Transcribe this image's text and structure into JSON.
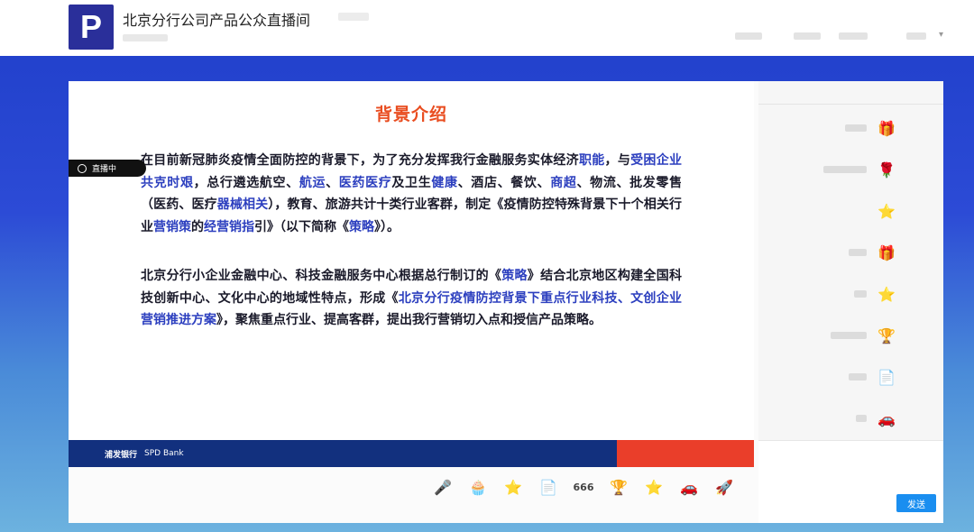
{
  "header": {
    "logo_letter": "P",
    "title": "北京分行公司产品公众直播间",
    "controls": [
      "",
      "",
      "",
      ""
    ]
  },
  "slide": {
    "heading": "背景介绍",
    "para1": [
      {
        "t": "在目前新冠肺炎疫情全面防控的背景下，为了充分发挥我行金融服务实体经济",
        "c": ""
      },
      {
        "t": "职能",
        "c": "blue"
      },
      {
        "t": "，与",
        "c": ""
      },
      {
        "t": "受困企业共克时艰",
        "c": "blue"
      },
      {
        "t": "，总行遴选航空、",
        "c": ""
      },
      {
        "t": "航运",
        "c": "blue"
      },
      {
        "t": "、",
        "c": ""
      },
      {
        "t": "医药医疗",
        "c": "blue"
      },
      {
        "t": "及卫生",
        "c": ""
      },
      {
        "t": "健康",
        "c": "blue"
      },
      {
        "t": "、酒店、餐饮、",
        "c": ""
      },
      {
        "t": "商超",
        "c": "blue"
      },
      {
        "t": "、物流、批发零售（医药、医疗",
        "c": ""
      },
      {
        "t": "器械相关",
        "c": "blue"
      },
      {
        "t": "），教育、旅游共计十类行业客群，制定《疫情防控特殊背景下十个相关行业",
        "c": ""
      },
      {
        "t": "营销策",
        "c": "blue"
      },
      {
        "t": "的",
        "c": ""
      },
      {
        "t": "经营销指",
        "c": "blue"
      },
      {
        "t": "引》（以下简称《",
        "c": ""
      },
      {
        "t": "策略",
        "c": "blue"
      },
      {
        "t": "》）。",
        "c": ""
      }
    ],
    "para2": [
      {
        "t": "北京分行小企业金融中心、科技金融服务中心根据总行制订的《",
        "c": ""
      },
      {
        "t": "策略",
        "c": "blue"
      },
      {
        "t": "》结合北京地区构建全国科技创新中心、文化中心的地域性特点，形成《",
        "c": ""
      },
      {
        "t": "北京分行疫情防控背景下重点行业科技、文创企业营销推进方案",
        "c": "blue"
      },
      {
        "t": "》，聚焦重点行业、提高客群，提出我行营销切入点和授信产品策略。",
        "c": ""
      }
    ],
    "footer_brand": "浦发银行",
    "footer_en": "SPD Bank"
  },
  "live_badge": "直播中",
  "side": {
    "tabs": [
      "",
      ""
    ],
    "messages": [
      {
        "gift_icon": "gift-icon",
        "glyph": "🎁"
      },
      {
        "gift_icon": "flower-icon",
        "glyph": "🌹"
      },
      {
        "gift_icon": "star-icon",
        "glyph": "⭐"
      },
      {
        "gift_icon": "gift-icon",
        "glyph": "🎁"
      },
      {
        "gift_icon": "star-icon",
        "glyph": "⭐"
      },
      {
        "gift_icon": "trophy-icon",
        "glyph": "🏆"
      },
      {
        "gift_icon": "paper-icon",
        "glyph": "📄"
      },
      {
        "gift_icon": "car-icon",
        "glyph": "🚗"
      }
    ],
    "input_placeholder": "",
    "send_label": "发送"
  },
  "gifts": [
    {
      "icon": "mic-icon",
      "glyph": "🎤"
    },
    {
      "icon": "cake-icon",
      "glyph": "🧁"
    },
    {
      "icon": "star-icon",
      "glyph": "⭐"
    },
    {
      "icon": "paper-icon",
      "glyph": "📄"
    },
    {
      "icon": "666-icon",
      "glyph": "666"
    },
    {
      "icon": "trophy-icon",
      "glyph": "🏆"
    },
    {
      "icon": "star-icon",
      "glyph": "⭐"
    },
    {
      "icon": "car-icon",
      "glyph": "🚗"
    },
    {
      "icon": "rocket-icon",
      "glyph": "🚀"
    }
  ]
}
